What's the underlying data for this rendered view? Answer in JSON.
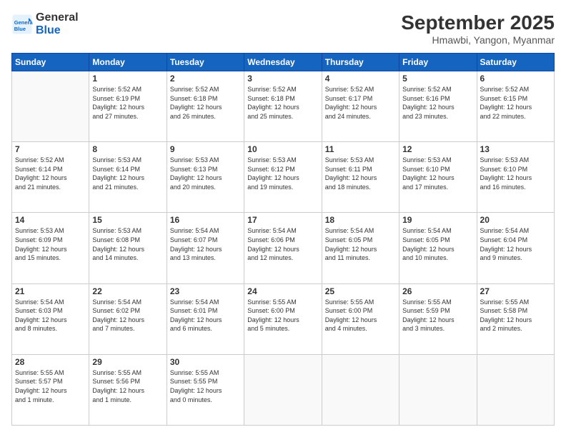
{
  "header": {
    "logo_general": "General",
    "logo_blue": "Blue",
    "month_title": "September 2025",
    "subtitle": "Hmawbi, Yangon, Myanmar"
  },
  "weekdays": [
    "Sunday",
    "Monday",
    "Tuesday",
    "Wednesday",
    "Thursday",
    "Friday",
    "Saturday"
  ],
  "weeks": [
    [
      {
        "day": "",
        "info": ""
      },
      {
        "day": "1",
        "info": "Sunrise: 5:52 AM\nSunset: 6:19 PM\nDaylight: 12 hours\nand 27 minutes."
      },
      {
        "day": "2",
        "info": "Sunrise: 5:52 AM\nSunset: 6:18 PM\nDaylight: 12 hours\nand 26 minutes."
      },
      {
        "day": "3",
        "info": "Sunrise: 5:52 AM\nSunset: 6:18 PM\nDaylight: 12 hours\nand 25 minutes."
      },
      {
        "day": "4",
        "info": "Sunrise: 5:52 AM\nSunset: 6:17 PM\nDaylight: 12 hours\nand 24 minutes."
      },
      {
        "day": "5",
        "info": "Sunrise: 5:52 AM\nSunset: 6:16 PM\nDaylight: 12 hours\nand 23 minutes."
      },
      {
        "day": "6",
        "info": "Sunrise: 5:52 AM\nSunset: 6:15 PM\nDaylight: 12 hours\nand 22 minutes."
      }
    ],
    [
      {
        "day": "7",
        "info": "Sunrise: 5:52 AM\nSunset: 6:14 PM\nDaylight: 12 hours\nand 21 minutes."
      },
      {
        "day": "8",
        "info": "Sunrise: 5:53 AM\nSunset: 6:14 PM\nDaylight: 12 hours\nand 21 minutes."
      },
      {
        "day": "9",
        "info": "Sunrise: 5:53 AM\nSunset: 6:13 PM\nDaylight: 12 hours\nand 20 minutes."
      },
      {
        "day": "10",
        "info": "Sunrise: 5:53 AM\nSunset: 6:12 PM\nDaylight: 12 hours\nand 19 minutes."
      },
      {
        "day": "11",
        "info": "Sunrise: 5:53 AM\nSunset: 6:11 PM\nDaylight: 12 hours\nand 18 minutes."
      },
      {
        "day": "12",
        "info": "Sunrise: 5:53 AM\nSunset: 6:10 PM\nDaylight: 12 hours\nand 17 minutes."
      },
      {
        "day": "13",
        "info": "Sunrise: 5:53 AM\nSunset: 6:10 PM\nDaylight: 12 hours\nand 16 minutes."
      }
    ],
    [
      {
        "day": "14",
        "info": "Sunrise: 5:53 AM\nSunset: 6:09 PM\nDaylight: 12 hours\nand 15 minutes."
      },
      {
        "day": "15",
        "info": "Sunrise: 5:53 AM\nSunset: 6:08 PM\nDaylight: 12 hours\nand 14 minutes."
      },
      {
        "day": "16",
        "info": "Sunrise: 5:54 AM\nSunset: 6:07 PM\nDaylight: 12 hours\nand 13 minutes."
      },
      {
        "day": "17",
        "info": "Sunrise: 5:54 AM\nSunset: 6:06 PM\nDaylight: 12 hours\nand 12 minutes."
      },
      {
        "day": "18",
        "info": "Sunrise: 5:54 AM\nSunset: 6:05 PM\nDaylight: 12 hours\nand 11 minutes."
      },
      {
        "day": "19",
        "info": "Sunrise: 5:54 AM\nSunset: 6:05 PM\nDaylight: 12 hours\nand 10 minutes."
      },
      {
        "day": "20",
        "info": "Sunrise: 5:54 AM\nSunset: 6:04 PM\nDaylight: 12 hours\nand 9 minutes."
      }
    ],
    [
      {
        "day": "21",
        "info": "Sunrise: 5:54 AM\nSunset: 6:03 PM\nDaylight: 12 hours\nand 8 minutes."
      },
      {
        "day": "22",
        "info": "Sunrise: 5:54 AM\nSunset: 6:02 PM\nDaylight: 12 hours\nand 7 minutes."
      },
      {
        "day": "23",
        "info": "Sunrise: 5:54 AM\nSunset: 6:01 PM\nDaylight: 12 hours\nand 6 minutes."
      },
      {
        "day": "24",
        "info": "Sunrise: 5:55 AM\nSunset: 6:00 PM\nDaylight: 12 hours\nand 5 minutes."
      },
      {
        "day": "25",
        "info": "Sunrise: 5:55 AM\nSunset: 6:00 PM\nDaylight: 12 hours\nand 4 minutes."
      },
      {
        "day": "26",
        "info": "Sunrise: 5:55 AM\nSunset: 5:59 PM\nDaylight: 12 hours\nand 3 minutes."
      },
      {
        "day": "27",
        "info": "Sunrise: 5:55 AM\nSunset: 5:58 PM\nDaylight: 12 hours\nand 2 minutes."
      }
    ],
    [
      {
        "day": "28",
        "info": "Sunrise: 5:55 AM\nSunset: 5:57 PM\nDaylight: 12 hours\nand 1 minute."
      },
      {
        "day": "29",
        "info": "Sunrise: 5:55 AM\nSunset: 5:56 PM\nDaylight: 12 hours\nand 1 minute."
      },
      {
        "day": "30",
        "info": "Sunrise: 5:55 AM\nSunset: 5:55 PM\nDaylight: 12 hours\nand 0 minutes."
      },
      {
        "day": "",
        "info": ""
      },
      {
        "day": "",
        "info": ""
      },
      {
        "day": "",
        "info": ""
      },
      {
        "day": "",
        "info": ""
      }
    ]
  ]
}
